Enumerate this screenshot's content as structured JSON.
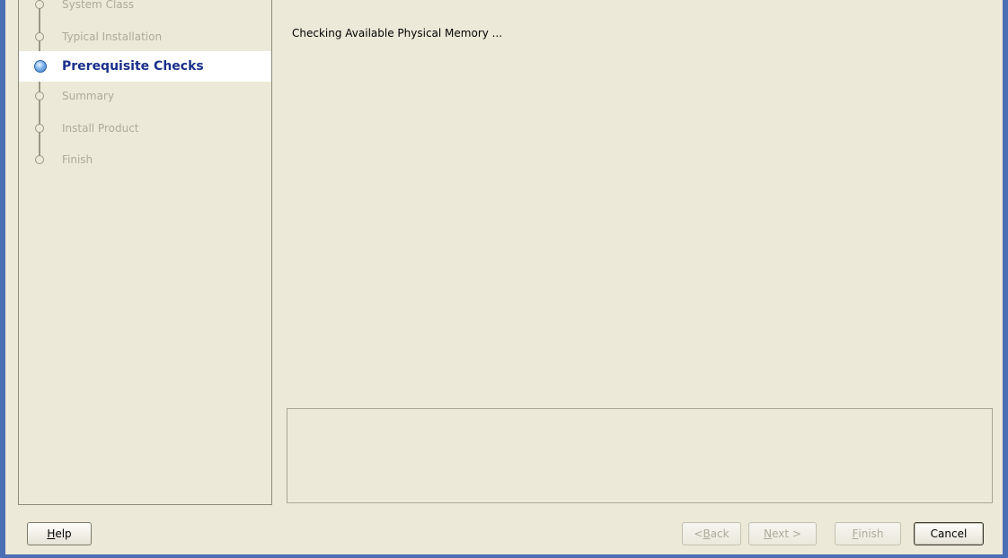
{
  "steps": [
    {
      "label": "System Class",
      "state": "done"
    },
    {
      "label": "Typical Installation",
      "state": "done"
    },
    {
      "label": "Prerequisite Checks",
      "state": "active"
    },
    {
      "label": "Summary",
      "state": "pending"
    },
    {
      "label": "Install Product",
      "state": "pending"
    },
    {
      "label": "Finish",
      "state": "pending"
    }
  ],
  "content": {
    "status_text": "Checking Available Physical Memory ..."
  },
  "buttons": {
    "help": {
      "mnemonic": "H",
      "rest": "elp"
    },
    "back": {
      "prefix": "< ",
      "mnemonic": "B",
      "rest": "ack"
    },
    "next": {
      "mnemonic": "N",
      "rest": "ext >"
    },
    "finish": {
      "mnemonic": "F",
      "rest": "inish"
    },
    "cancel": "Cancel"
  },
  "colors": {
    "active_step": "#1a2f8a",
    "disabled_text": "#aeaa99",
    "frame": "#4a6fb5"
  }
}
